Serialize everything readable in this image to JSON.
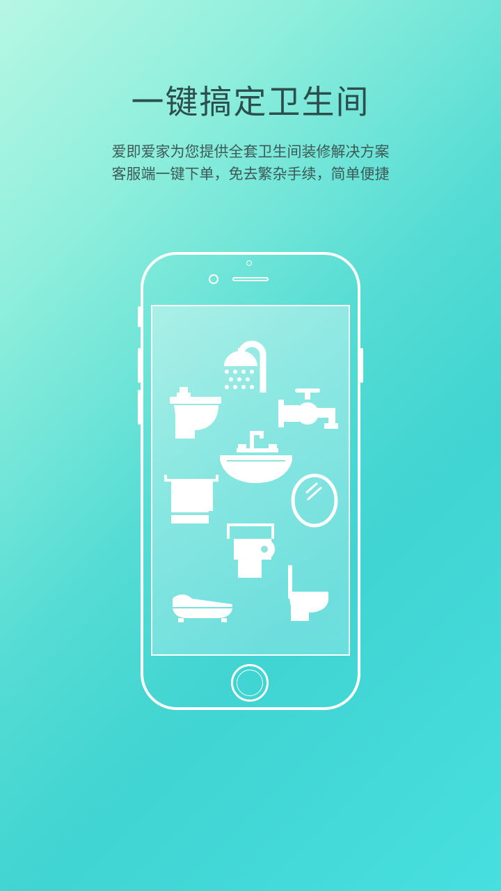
{
  "page": {
    "title": "一键搞定卫生间",
    "subtitle_line1": "爱即爱家为您提供全套卫生间装修解决方案",
    "subtitle_line2": "客服端一键下单，免去繁杂手续，简单便捷"
  },
  "colors": {
    "gradient_start": "#b6f7e4",
    "gradient_end": "#47dfdf",
    "title_text": "#2c4f4d",
    "outline": "#ffffff"
  },
  "phone_icons": [
    "shower-icon",
    "washbasin-icon",
    "faucet-icon",
    "sink-icon",
    "towel-rack-icon",
    "mirror-icon",
    "toilet-paper-icon",
    "bathtub-icon",
    "toilet-icon"
  ]
}
